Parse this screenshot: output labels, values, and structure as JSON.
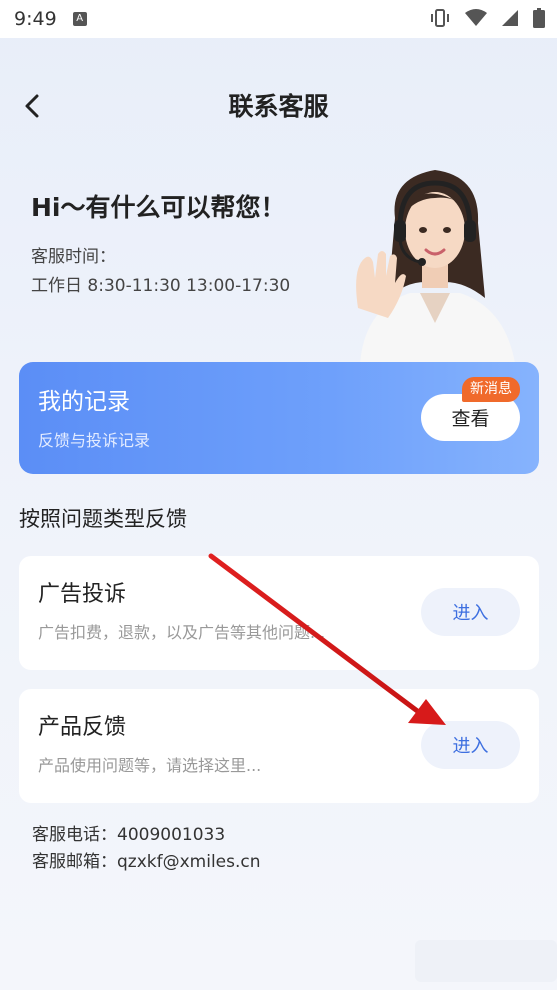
{
  "status_bar": {
    "time": "9:49",
    "notification_icon": "A"
  },
  "header": {
    "title": "联系客服"
  },
  "hero": {
    "greeting": "Hi～有什么可以帮您！",
    "service_time_label": "客服时间：",
    "service_hours": "工作日 8:30-11:30 13:00-17:30"
  },
  "records": {
    "title": "我的记录",
    "subtitle": "反馈与投诉记录",
    "button_label": "查看",
    "badge": "新消息"
  },
  "section": {
    "title": "按照问题类型反馈"
  },
  "feedback_types": [
    {
      "title": "广告投诉",
      "description": "广告扣费，退款，以及广告等其他问题...",
      "button_label": "进入"
    },
    {
      "title": "产品反馈",
      "description": "产品使用问题等，请选择这里...",
      "button_label": "进入"
    }
  ],
  "contact": {
    "phone": "客服电话：4009001033",
    "email": "客服邮箱：qzxkf@xmiles.cn"
  },
  "colors": {
    "accent_blue": "#5b8ef6",
    "badge_orange": "#f06a2b",
    "enter_text": "#3d6fe0",
    "annotation_arrow": "#e02020"
  },
  "icons": [
    "back-arrow-icon",
    "vibrate-icon",
    "wifi-icon",
    "signal-icon",
    "battery-icon"
  ]
}
